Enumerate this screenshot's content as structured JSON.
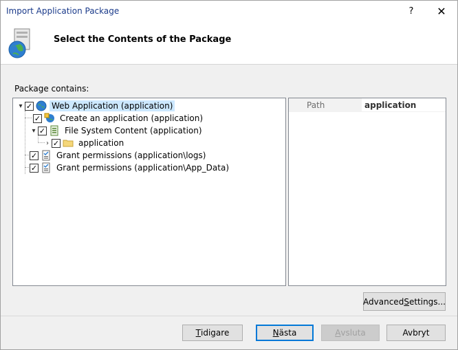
{
  "window": {
    "title": "Import Application Package"
  },
  "titlebar": {
    "help_label": "?",
    "close_label": "✕"
  },
  "header": {
    "title": "Select the Contents of the Package",
    "icon": "package-globe-icon"
  },
  "package": {
    "label": "Package contains:",
    "tree": [
      {
        "label": "Web Application (application)",
        "icon": "globe-icon",
        "checked": true,
        "expanded": true,
        "selected": true
      },
      {
        "label": "Create an application (application)",
        "icon": "create-app-icon",
        "checked": true
      },
      {
        "label": "File System Content (application)",
        "icon": "file-system-icon",
        "checked": true,
        "expanded": true
      },
      {
        "label": "application",
        "icon": "folder-icon",
        "checked": true,
        "expanded": false
      },
      {
        "label": "Grant permissions (application\\logs)",
        "icon": "permissions-icon",
        "checked": true
      },
      {
        "label": "Grant permissions (application\\App_Data)",
        "icon": "permissions-icon",
        "checked": true
      }
    ]
  },
  "properties": {
    "name": "Path",
    "value": "application"
  },
  "buttons": {
    "advanced": {
      "pre": "Advanced ",
      "key": "S",
      "post": "ettings..."
    },
    "previous": {
      "key": "T",
      "post": "idigare"
    },
    "next": {
      "key": "N",
      "post": "ästa"
    },
    "finish": {
      "key": "A",
      "post": "vsluta"
    },
    "cancel": "Avbryt"
  },
  "colors": {
    "selection": "#cce8ff",
    "default_button_border": "#0078d7",
    "title_text": "#1a3a8a"
  }
}
